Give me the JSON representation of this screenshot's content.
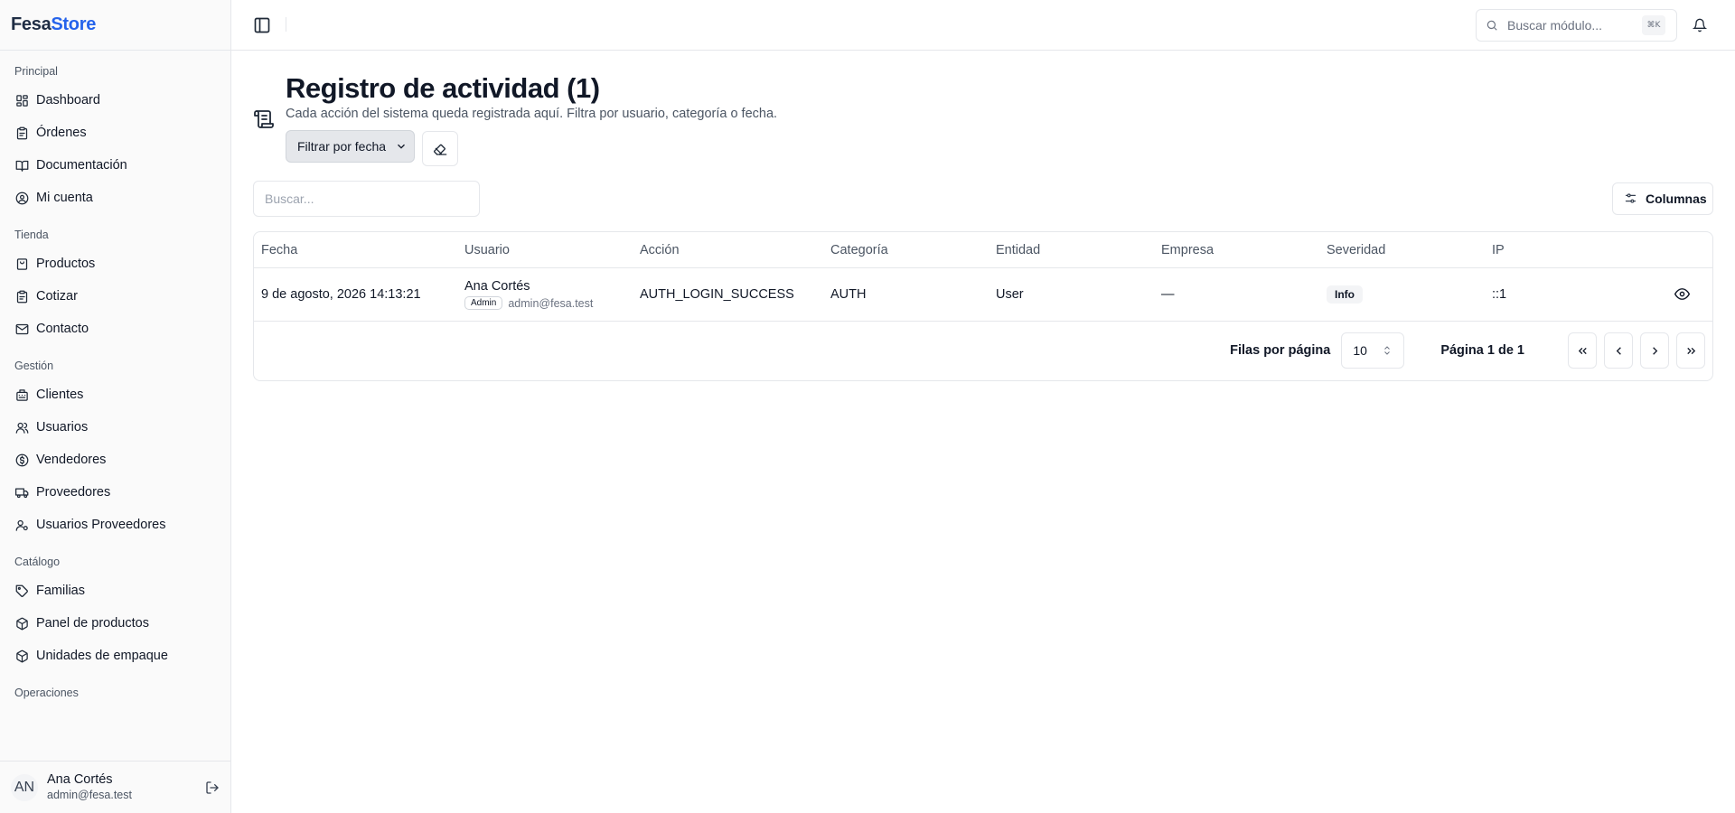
{
  "brand": {
    "part1": "Fesa",
    "part2": "Store"
  },
  "sidebar": {
    "groups": [
      {
        "label": "Principal",
        "items": [
          {
            "label": "Dashboard",
            "icon": "dashboard-icon"
          },
          {
            "label": "Órdenes",
            "icon": "clipboard-icon"
          },
          {
            "label": "Documentación",
            "icon": "book-icon"
          },
          {
            "label": "Mi cuenta",
            "icon": "user-circle-icon"
          }
        ]
      },
      {
        "label": "Tienda",
        "items": [
          {
            "label": "Productos",
            "icon": "box-icon"
          },
          {
            "label": "Cotizar",
            "icon": "clipboard-icon"
          },
          {
            "label": "Contacto",
            "icon": "mail-icon"
          }
        ]
      },
      {
        "label": "Gestión",
        "items": [
          {
            "label": "Clientes",
            "icon": "building-icon"
          },
          {
            "label": "Usuarios",
            "icon": "users-icon"
          },
          {
            "label": "Vendedores",
            "icon": "coin-icon"
          },
          {
            "label": "Proveedores",
            "icon": "truck-icon"
          },
          {
            "label": "Usuarios Proveedores",
            "icon": "user-cog-icon"
          }
        ]
      },
      {
        "label": "Catálogo",
        "items": [
          {
            "label": "Familias",
            "icon": "tag-icon"
          },
          {
            "label": "Panel de productos",
            "icon": "package-icon"
          },
          {
            "label": "Unidades de empaque",
            "icon": "package-icon"
          }
        ]
      },
      {
        "label": "Operaciones",
        "items": []
      }
    ]
  },
  "user": {
    "initials": "AN",
    "name": "Ana Cortés",
    "email": "admin@fesa.test"
  },
  "topbar": {
    "search_placeholder": "Buscar módulo...",
    "shortcut": "⌘K"
  },
  "page": {
    "title": "Registro de actividad (1)",
    "subtitle": "Cada acción del sistema queda registrada aquí. Filtra por usuario, categoría o fecha.",
    "filter_label": "Filtrar por fecha",
    "search_placeholder": "Buscar...",
    "columns_label": "Columnas"
  },
  "table": {
    "headers": [
      "Fecha",
      "Usuario",
      "Acción",
      "Categoría",
      "Entidad",
      "Empresa",
      "Severidad",
      "IP"
    ],
    "rows": [
      {
        "fecha": "9 de agosto, 2026 14:13:21",
        "usuario": "Ana Cortés",
        "rol": "Admin",
        "email": "admin@fesa.test",
        "accion": "AUTH_LOGIN_SUCCESS",
        "categoria": "AUTH",
        "entidad": "User",
        "empresa": "—",
        "severidad": "Info",
        "ip": "::1"
      }
    ]
  },
  "pagination": {
    "rows_label": "Filas por página",
    "rows_value": "10",
    "page_label": "Página 1 de 1"
  }
}
